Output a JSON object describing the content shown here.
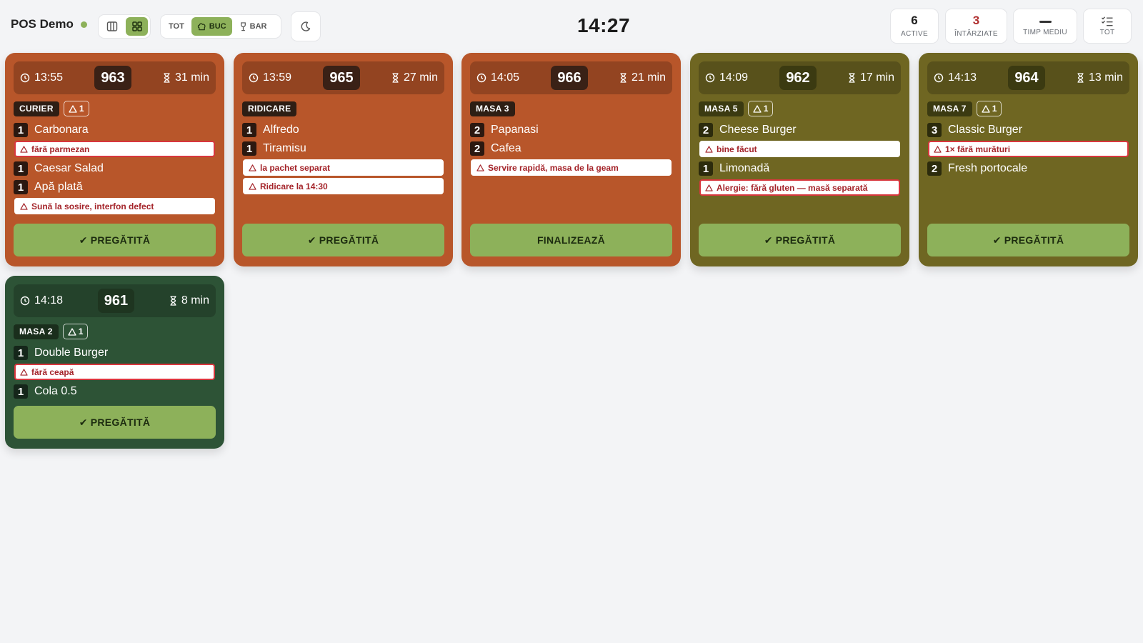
{
  "header": {
    "brand": "POS Demo",
    "stations": [
      "TOT",
      "BUC",
      "BAR"
    ],
    "clock": "14:27",
    "stats": {
      "active_value": "6",
      "active_label": "ACTIVE",
      "late_value": "3",
      "late_label": "ÎNTÂRZIATE",
      "avg_label": "TIMP MEDIU",
      "filter_label": "TOT"
    }
  },
  "colors": {
    "late": "#b8562a",
    "warning": "#6f6622",
    "fresh": "#2d5336",
    "action": "#8db15a"
  },
  "tickets": [
    {
      "time": "13:55",
      "number": "963",
      "elapsed": "31 min",
      "tag": "CURIER",
      "warn_count": "1",
      "items": [
        {
          "qty": "1",
          "name": "Carbonara",
          "note": "fără parmezan"
        },
        {
          "qty": "1",
          "name": "Caesar Salad"
        },
        {
          "qty": "1",
          "name": "Apă plată"
        }
      ],
      "order_note": "Sună la sosire, interfon defect",
      "action": "PREGĂTITĂ"
    },
    {
      "time": "13:59",
      "number": "965",
      "elapsed": "27 min",
      "tag": "RIDICARE",
      "items": [
        {
          "qty": "1",
          "name": "Alfredo"
        },
        {
          "qty": "1",
          "name": "Tiramisu"
        }
      ],
      "notes": [
        "la pachet separat",
        "Ridicare la 14:30"
      ],
      "action": "PREGĂTITĂ"
    },
    {
      "time": "14:05",
      "number": "966",
      "elapsed": "21 min",
      "tag": "MASA 3",
      "items": [
        {
          "qty": "2",
          "name": "Papanasi"
        },
        {
          "qty": "2",
          "name": "Cafea"
        }
      ],
      "order_note": "Servire rapidă, masa de la geam",
      "action": "FINALIZEAZĂ"
    },
    {
      "time": "14:09",
      "number": "962",
      "elapsed": "17 min",
      "tag": "MASA 5",
      "warn_count": "1",
      "items": [
        {
          "qty": "2",
          "name": "Cheese Burger",
          "note": "bine făcut"
        },
        {
          "qty": "1",
          "name": "Limonadă"
        }
      ],
      "order_note": "Alergie: fără gluten — masă separată",
      "action": "PREGĂTITĂ"
    },
    {
      "time": "14:13",
      "number": "964",
      "elapsed": "13 min",
      "tag": "MASA 7",
      "warn_count": "1",
      "items": [
        {
          "qty": "3",
          "name": "Classic Burger",
          "note": "1× fără murături"
        },
        {
          "qty": "2",
          "name": "Fresh portocale"
        }
      ],
      "action": "PREGĂTITĂ"
    },
    {
      "time": "14:18",
      "number": "961",
      "elapsed": "8 min",
      "tag": "MASA 2",
      "warn_count": "1",
      "items": [
        {
          "qty": "1",
          "name": "Double Burger",
          "note": "fără ceapă"
        },
        {
          "qty": "1",
          "name": "Cola 0.5"
        }
      ],
      "action": "PREGĂTITĂ"
    }
  ]
}
